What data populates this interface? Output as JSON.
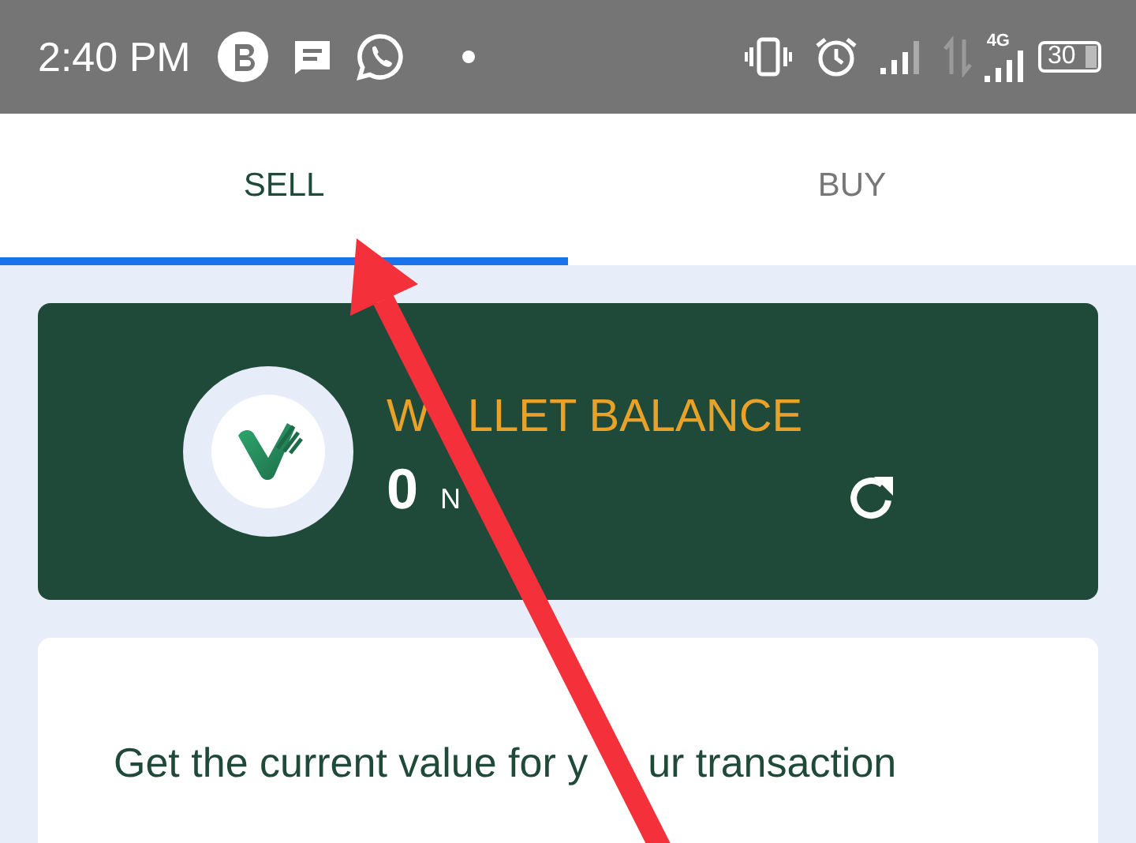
{
  "status_bar": {
    "time": "2:40 PM",
    "network_label": "4G",
    "battery": "30"
  },
  "tabs": [
    {
      "label": "SELL",
      "selected": true
    },
    {
      "label": "BUY",
      "selected": false
    }
  ],
  "wallet": {
    "title_parts": [
      "W",
      "LLET BALANCE"
    ],
    "amount": "0",
    "currency": "N"
  },
  "info_card": {
    "text_parts": [
      "Get the current value for y",
      "ur transaction"
    ]
  }
}
